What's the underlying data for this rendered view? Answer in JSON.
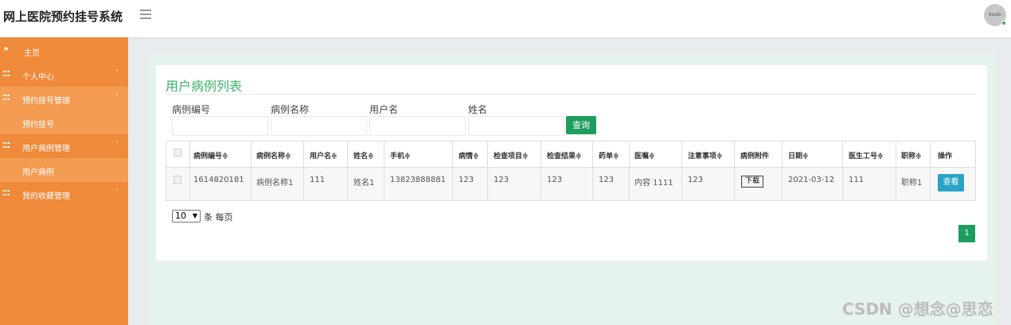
{
  "app": {
    "title": "网上医院预约挂号系统",
    "avatar_text": "80x80"
  },
  "sidebar": {
    "items": [
      {
        "label": "主页",
        "icon": "flag-icon"
      },
      {
        "label": "个人中心",
        "icon": "grid-icon"
      },
      {
        "label": "预约挂号管理",
        "icon": "grid-icon"
      },
      {
        "label": "预约挂号",
        "icon": ""
      },
      {
        "label": "用户病例管理",
        "icon": "grid-icon"
      },
      {
        "label": "用户病例",
        "icon": ""
      },
      {
        "label": "我的收藏管理",
        "icon": "grid-icon"
      }
    ]
  },
  "page": {
    "title": "用户病例列表"
  },
  "filters": {
    "labels": [
      "病例编号",
      "病例名称",
      "用户名",
      "姓名"
    ],
    "search_label": "查询"
  },
  "table": {
    "headers": [
      "病例编号≑",
      "病例名称≑",
      "用户名≑",
      "姓名≑",
      "手机≑",
      "病情≑",
      "检查项目≑",
      "检查结果≑",
      "药单≑",
      "医嘱≑",
      "注意事项≑",
      "病例附件",
      "日期≑",
      "医生工号≑",
      "职称≑",
      "操作"
    ],
    "rows": [
      {
        "cells": [
          "1614820181",
          "病例名称1",
          "111",
          "姓名1",
          "13823888881",
          "123",
          "123",
          "123",
          "123",
          "内容 1111",
          "123",
          "",
          "2021-03-12",
          "111",
          "职称1"
        ],
        "download_label": "下载",
        "view_label": "查看"
      }
    ]
  },
  "pagination": {
    "page_size": "10",
    "per_page_label": "条 每页",
    "current_page": "1"
  },
  "watermark": "CSDN @想念@思恋",
  "colors": {
    "sidebar": "#ef8a3a",
    "accent_green": "#1e9e5e",
    "title_green": "#3bb26c",
    "view_blue": "#2aa3c6"
  }
}
